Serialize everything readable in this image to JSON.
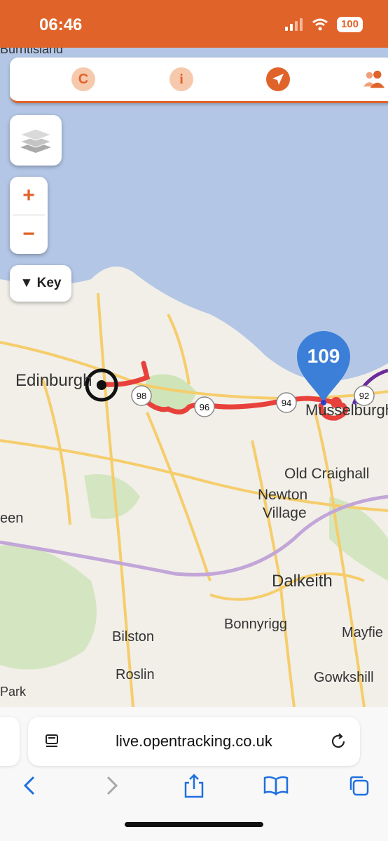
{
  "status_bar": {
    "time": "06:46",
    "battery": "100"
  },
  "toolbar": {
    "items": [
      {
        "icon": "c-logo-icon",
        "label": "C"
      },
      {
        "icon": "info-icon",
        "label": "i"
      },
      {
        "icon": "locate-arrow-icon"
      },
      {
        "icon": "people-icon"
      }
    ]
  },
  "map_controls": {
    "zoom_in": "+",
    "zoom_out": "−",
    "key_label": "▼ Key"
  },
  "map": {
    "places": [
      "Burntisland",
      "Edinburgh",
      "Musselburgh",
      "Old Craighall",
      "Newton",
      "Village",
      "een",
      "Dalkeith",
      "Bonnyrigg",
      "Mayfie",
      "Bilston",
      "Roslin",
      "Gowkshill",
      "Park"
    ],
    "distance_markers": [
      "98",
      "96",
      "94",
      "92"
    ],
    "tracker_pin": "109",
    "colors": {
      "route": "#e8413b",
      "pin": "#3b7fd8",
      "water": "#b3c6e6",
      "land": "#f2efe9",
      "accent": "#e0632a"
    }
  },
  "browser": {
    "url": "live.opentracking.co.uk"
  }
}
